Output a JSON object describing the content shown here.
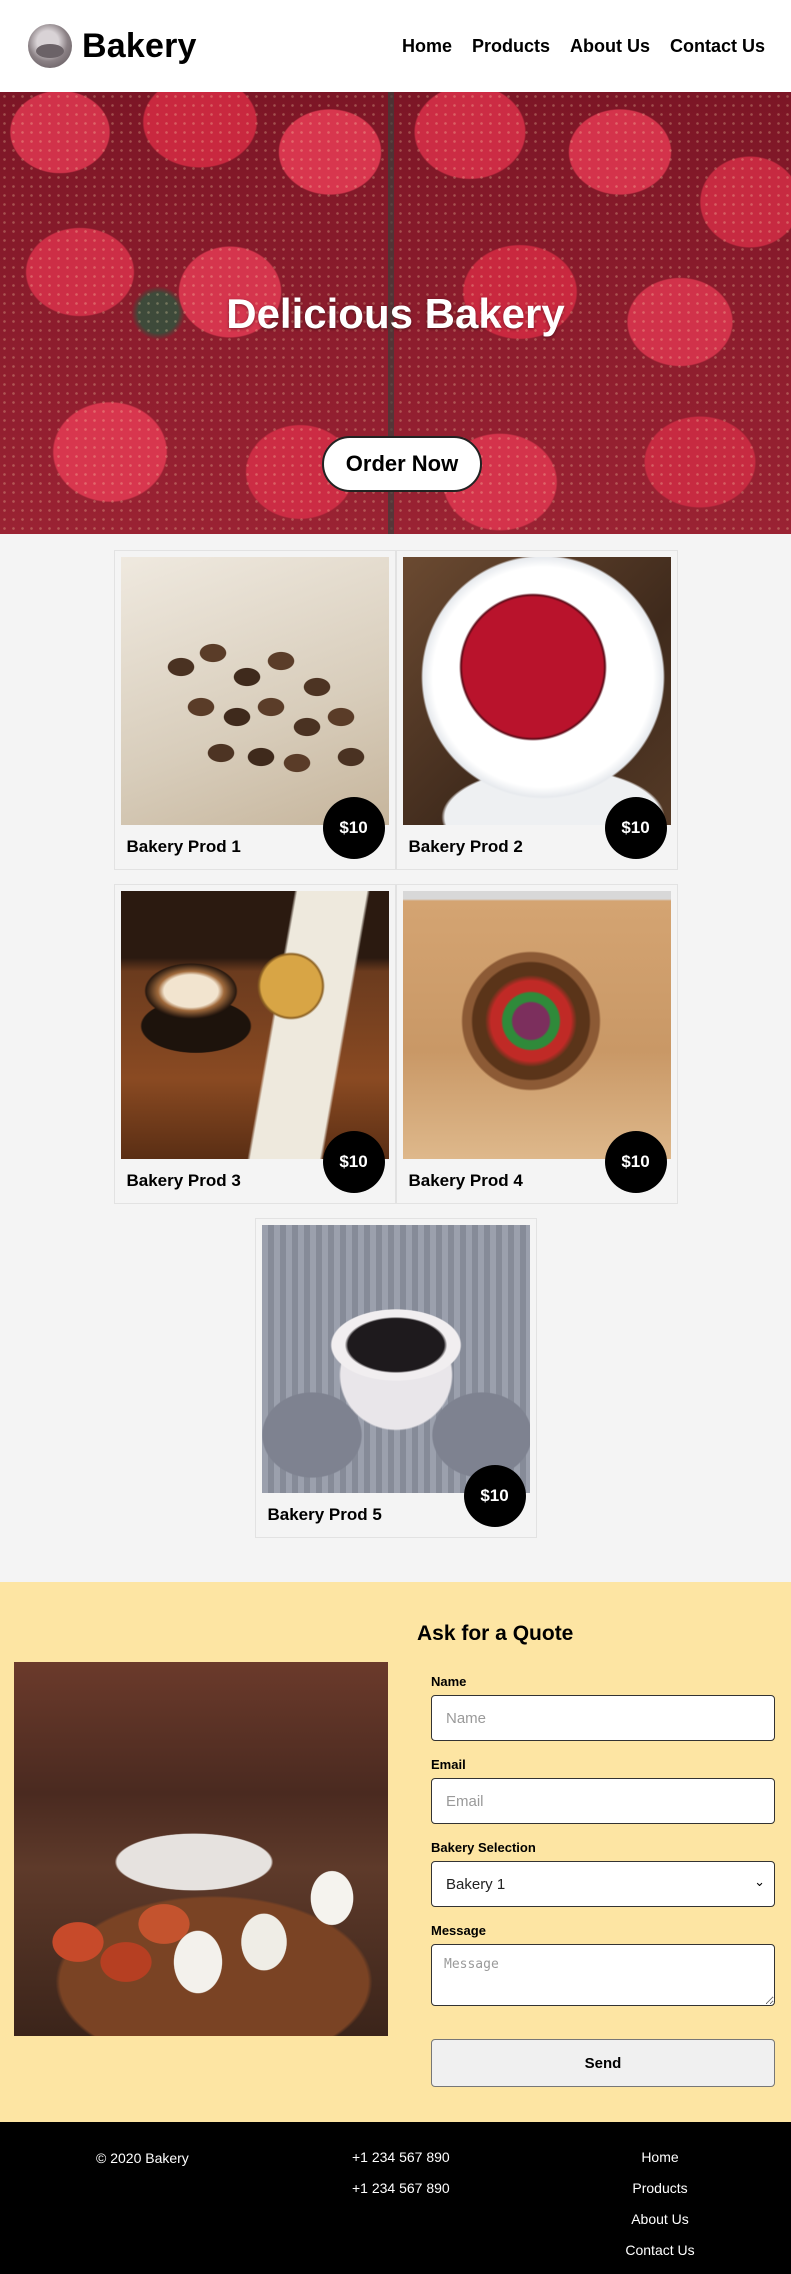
{
  "header": {
    "brand": "Bakery",
    "nav": [
      "Home",
      "Products",
      "About Us",
      "Contact Us"
    ]
  },
  "hero": {
    "title": "Delicious Bakery",
    "cta": "Order Now"
  },
  "products": [
    {
      "name": "Bakery Prod 1",
      "price": "$10",
      "image": "coffee-beans"
    },
    {
      "name": "Bakery Prod 2",
      "price": "$10",
      "image": "raspberries-bowl"
    },
    {
      "name": "Bakery Prod 3",
      "price": "$10",
      "image": "latte-cup"
    },
    {
      "name": "Bakery Prod 4",
      "price": "$10",
      "image": "salad-bowl"
    },
    {
      "name": "Bakery Prod 5",
      "price": "$10",
      "image": "coffee-mug"
    }
  ],
  "quote": {
    "title": "Ask for a Quote",
    "name_label": "Name",
    "name_placeholder": "Name",
    "email_label": "Email",
    "email_placeholder": "Email",
    "selection_label": "Bakery Selection",
    "selection_value": "Bakery 1",
    "message_label": "Message",
    "message_placeholder": "Message",
    "send_label": "Send"
  },
  "footer": {
    "copyright": "© 2020 Bakery",
    "phones": [
      "+1 234 567 890",
      "+1 234 567 890"
    ],
    "links": [
      "Home",
      "Products",
      "About Us",
      "Contact Us"
    ]
  },
  "colors": {
    "quote_background": "#fde5a3",
    "footer_background": "#000000",
    "price_badge": "#000000"
  }
}
